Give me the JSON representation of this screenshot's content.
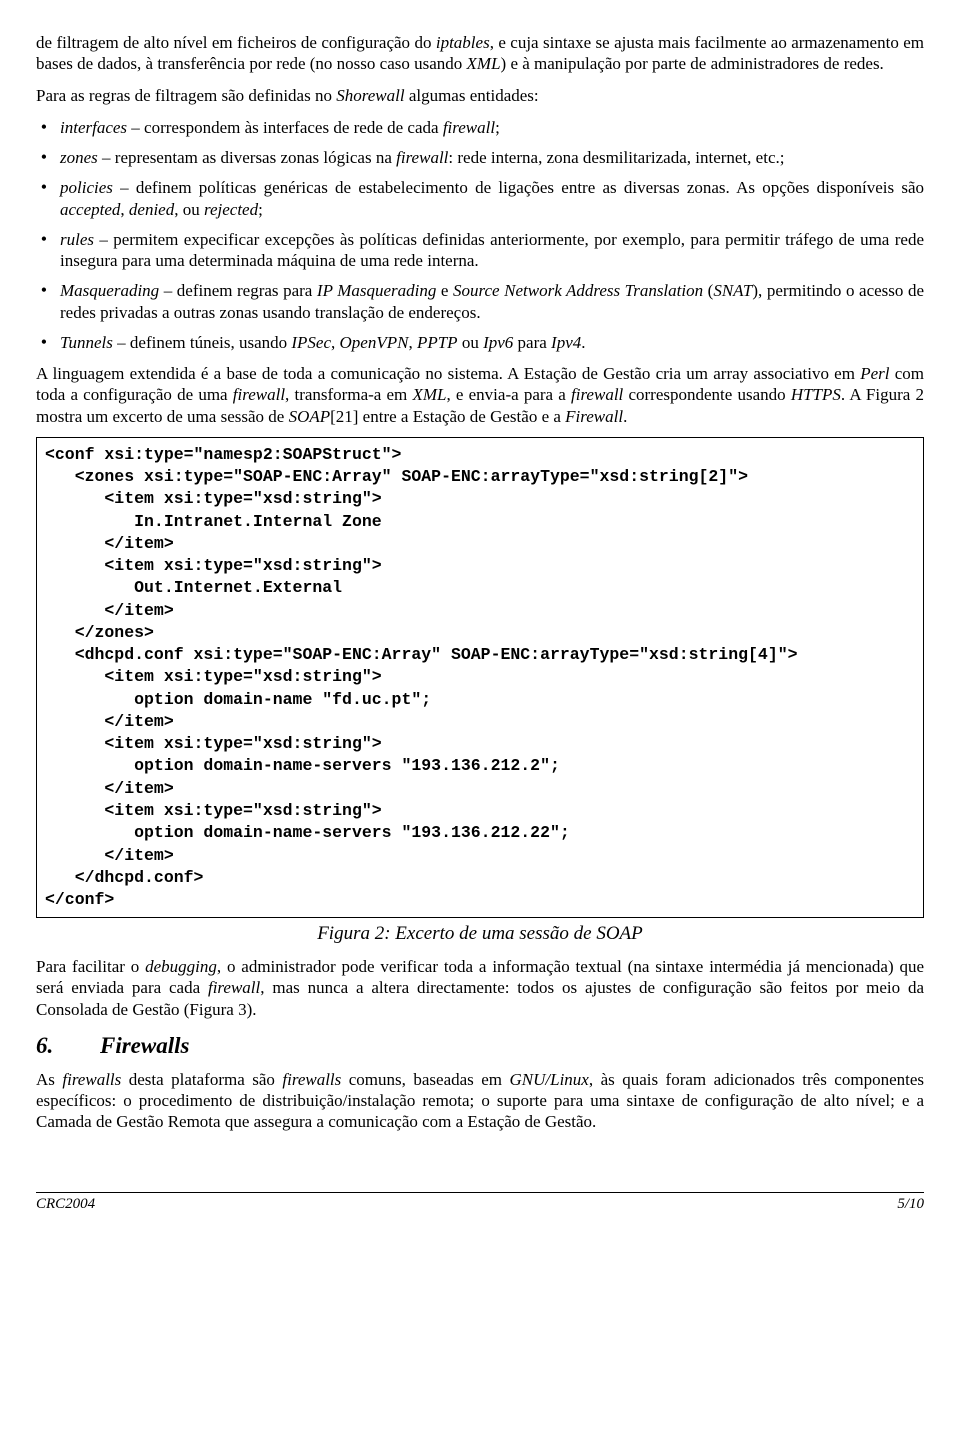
{
  "para_intro": "de filtragem de alto nível em ficheiros de configuração do <i>iptables</i>, e cuja sintaxe se ajusta mais facilmente ao armazenamento em bases de dados, à transferência por rede (no nosso caso usando <i>XML</i>) e à manipulação por parte de administradores de redes.",
  "para_entidades": "Para as regras de filtragem são definidas no <i>Shorewall</i> algumas entidades:",
  "bullets_a": [
    "<i>interfaces</i> – correspondem às interfaces de rede de cada <i>firewall</i>;",
    "<i>zones</i> – representam as diversas zonas lógicas na <i>firewall</i>: rede interna, zona desmilitarizada, internet, etc.;",
    "<i>policies</i> – definem políticas genéricas de estabelecimento de ligações entre as diversas zonas. As opções disponíveis são <i>accepted</i>, <i>denied</i>, ou <i>rejected</i>;",
    "<i>rules</i> – permitem expecificar excepções às políticas definidas anteriormente, por exemplo, para permitir tráfego de uma rede insegura para uma determinada máquina de uma rede interna.",
    "<i>Masquerading</i> – definem regras para <i>IP Masquerading</i> e <i>Source Network Address Translation</i> (<i>SNAT</i>), permitindo o acesso de redes privadas a outras zonas usando translação de endereços.",
    "<i>Tunnels</i> – definem túneis, usando <i>IPSec</i>, <i>OpenVPN</i>, <i>PPTP</i> ou <i>Ipv6</i> para <i>Ipv4</i>."
  ],
  "para_linguagem": "A linguagem extendida é a base de toda a comunicação no sistema. A Estação de Gestão cria um array associativo em <i>Perl</i> com toda a configuração de uma <i>firewall</i>, transforma-a em <i>XML</i>, e envia-a para a <i>firewall</i> correspondente usando <i>HTTPS</i>. A Figura 2 mostra um excerto de uma sessão de <i>SOAP</i>[21] entre a Estação de Gestão e a <i>Firewall</i>.",
  "code": "<conf xsi:type=\"namesp2:SOAPStruct\">\n   <zones xsi:type=\"SOAP-ENC:Array\" SOAP-ENC:arrayType=\"xsd:string[2]\">\n      <item xsi:type=\"xsd:string\">\n         In.Intranet.Internal Zone\n      </item>\n      <item xsi:type=\"xsd:string\">\n         Out.Internet.External\n      </item>\n   </zones>\n   <dhcpd.conf xsi:type=\"SOAP-ENC:Array\" SOAP-ENC:arrayType=\"xsd:string[4]\">\n      <item xsi:type=\"xsd:string\">\n         option domain-name \"fd.uc.pt\";\n      </item>\n      <item xsi:type=\"xsd:string\">\n         option domain-name-servers \"193.136.212.2\";\n      </item>\n      <item xsi:type=\"xsd:string\">\n         option domain-name-servers \"193.136.212.22\";\n      </item>\n   </dhcpd.conf>\n</conf>",
  "caption": "Figura 2: Excerto de uma sessão de SOAP",
  "para_facilitar": "Para facilitar o <i>debugging</i>, o administrador pode verificar toda a informação textual (na sintaxe intermédia já mencionada) que será enviada para cada <i>firewall</i>, mas nunca a altera directamente: todos os ajustes de configuração são feitos por meio da Consolada de Gestão (Figura 3).",
  "section_num": "6.",
  "section_title": "Firewalls",
  "para_firewalls": "As <i>firewalls</i> desta plataforma são <i>firewalls</i> comuns, baseadas em <i>GNU/Linux</i>, às quais foram adicionados três componentes específicos: o procedimento de distribuição/instalação remota; o suporte para uma sintaxe de configuração de alto nível; e a Camada de Gestão Remota que assegura a comunicação com a Estação de Gestão.",
  "footer_left": "CRC2004",
  "footer_right": "5/10"
}
